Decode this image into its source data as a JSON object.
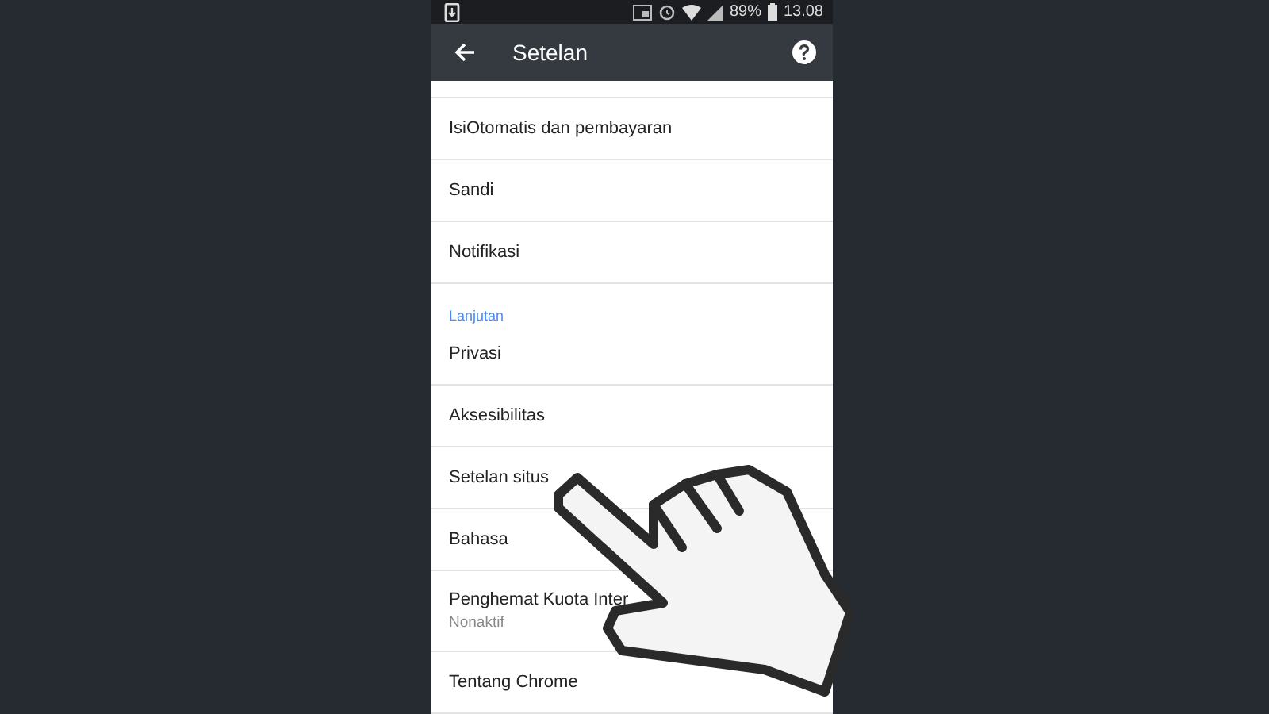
{
  "status_bar": {
    "battery_percent": "89%",
    "time": "13.08"
  },
  "app_bar": {
    "title": "Setelan"
  },
  "items": [
    {
      "kind": "row",
      "label": "IsiOtomatis dan pembayaran"
    },
    {
      "kind": "row",
      "label": "Sandi"
    },
    {
      "kind": "row",
      "label": "Notifikasi"
    },
    {
      "kind": "header",
      "label": "Lanjutan"
    },
    {
      "kind": "row",
      "label": "Privasi"
    },
    {
      "kind": "row",
      "label": "Aksesibilitas"
    },
    {
      "kind": "row",
      "label": "Setelan situs"
    },
    {
      "kind": "row",
      "label": "Bahasa"
    },
    {
      "kind": "row",
      "label": "Penghemat Kuota Inter",
      "summary": "Nonaktif"
    },
    {
      "kind": "row",
      "label": "Tentang Chrome"
    }
  ]
}
